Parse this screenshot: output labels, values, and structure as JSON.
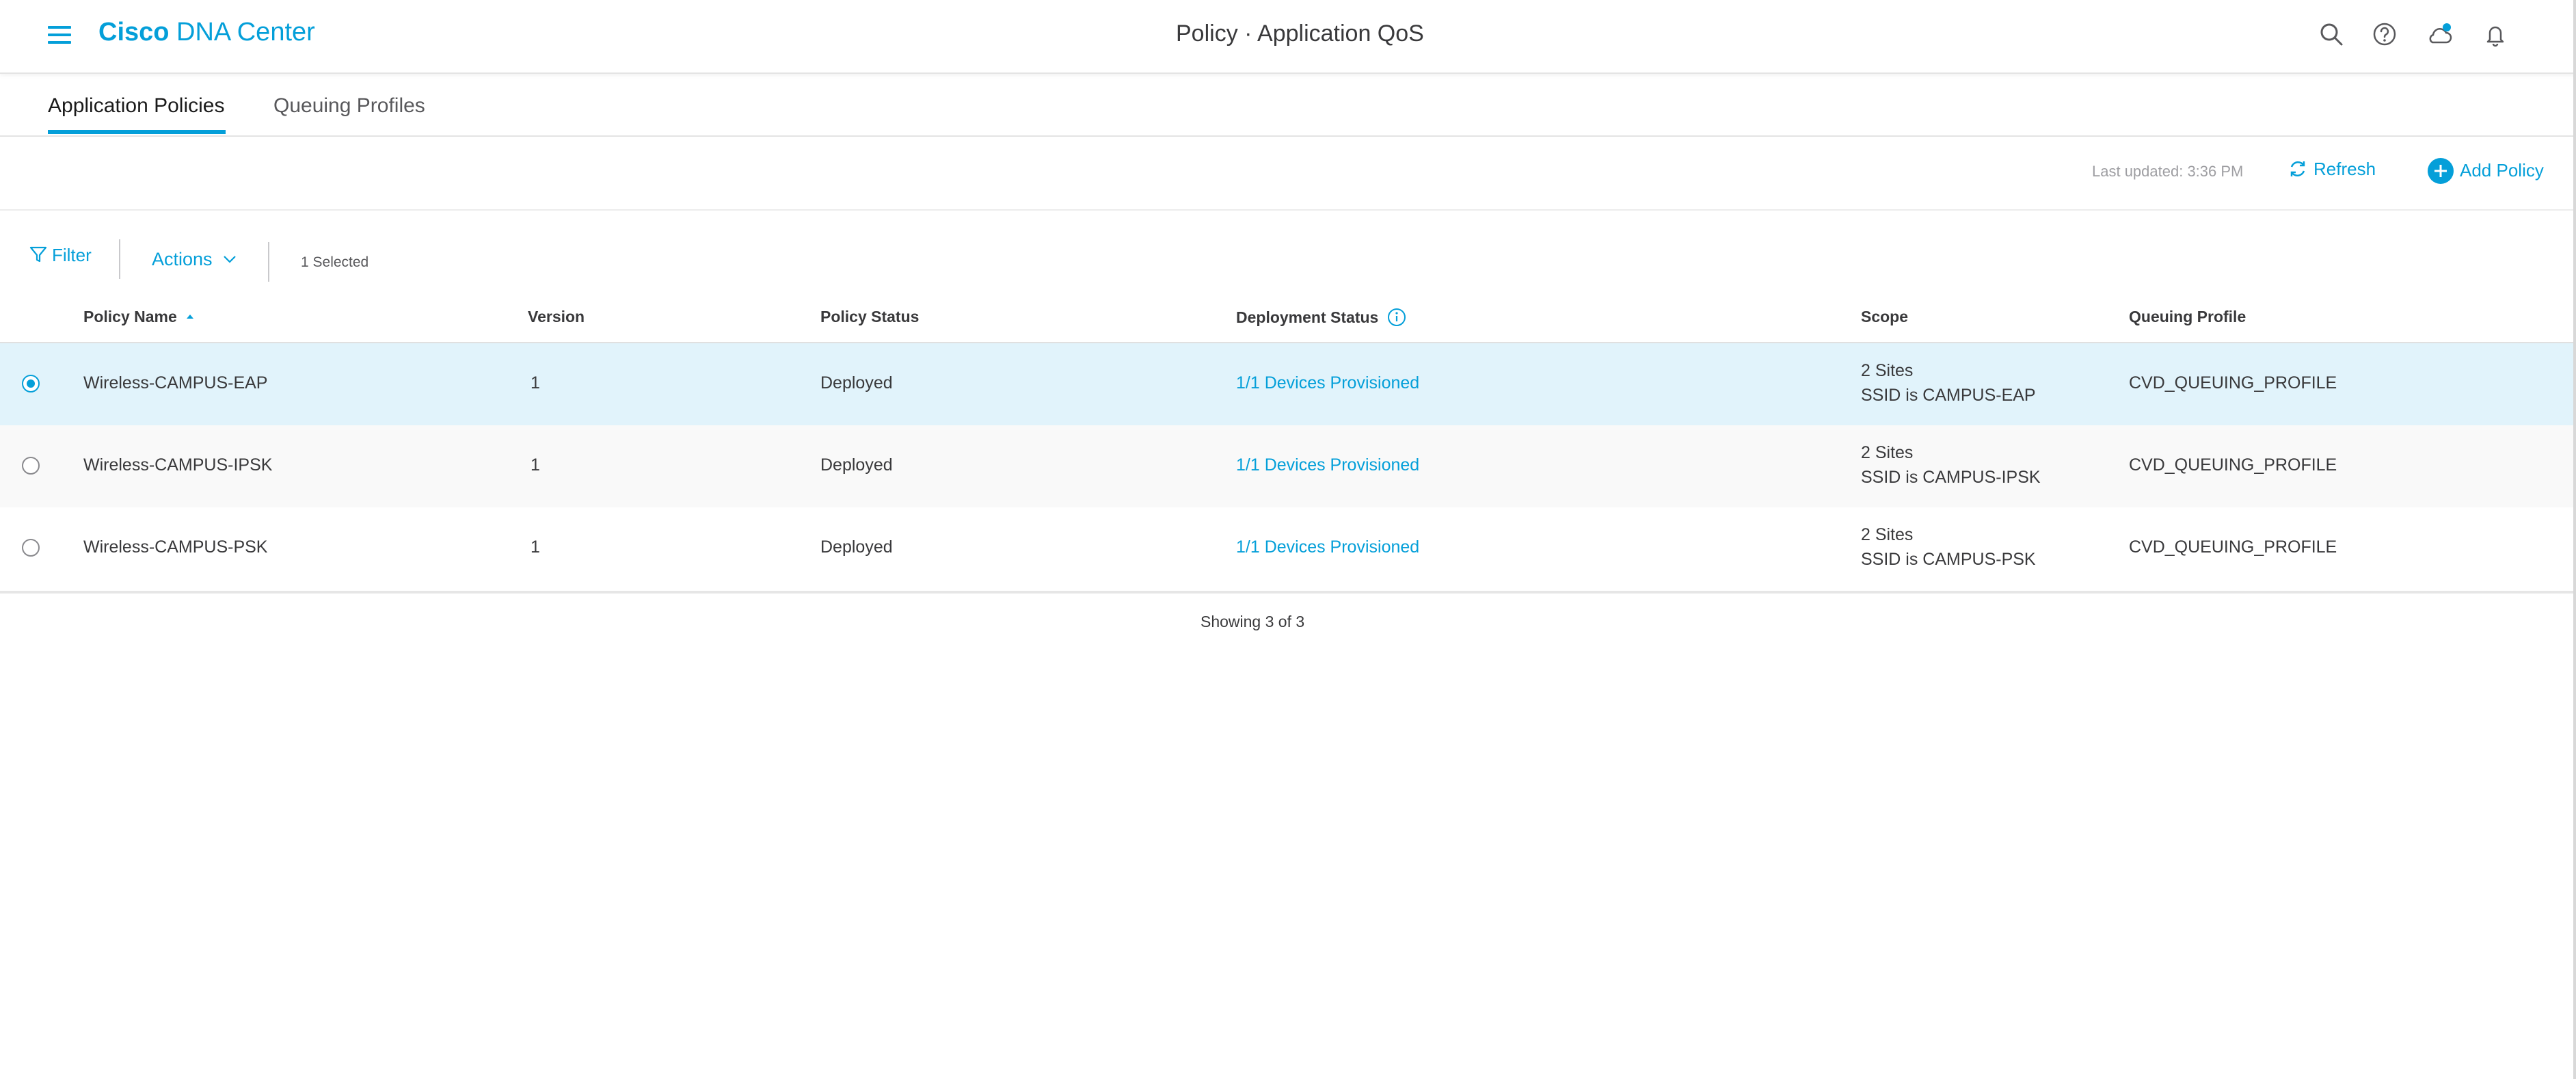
{
  "header": {
    "brand_bold": "Cisco",
    "brand_rest": "DNA Center",
    "page_title": "Policy · Application QoS",
    "icons": [
      "search-icon",
      "help-icon",
      "cloud-notification-icon",
      "bell-icon"
    ]
  },
  "tabs": [
    {
      "label": "Application Policies",
      "active": true
    },
    {
      "label": "Queuing Profiles",
      "active": false
    }
  ],
  "toolbar": {
    "last_updated": "Last updated: 3:36 PM",
    "refresh_label": "Refresh",
    "add_policy_label": "Add Policy",
    "filter_label": "Filter",
    "actions_label": "Actions",
    "selected_text": "1  Selected"
  },
  "table": {
    "columns": [
      "Policy Name",
      "Version",
      "Policy Status",
      "Deployment Status",
      "Scope",
      "Queuing Profile"
    ],
    "rows": [
      {
        "selected": true,
        "name": "Wireless-CAMPUS-EAP",
        "version": "1",
        "status": "Deployed",
        "deployment": "1/1 Devices Provisioned",
        "scope_sites": "2 Sites",
        "scope_ssid": "SSID is CAMPUS-EAP",
        "queuing": "CVD_QUEUING_PROFILE"
      },
      {
        "selected": false,
        "name": "Wireless-CAMPUS-IPSK",
        "version": "1",
        "status": "Deployed",
        "deployment": "1/1 Devices Provisioned",
        "scope_sites": "2 Sites",
        "scope_ssid": "SSID is CAMPUS-IPSK",
        "queuing": "CVD_QUEUING_PROFILE"
      },
      {
        "selected": false,
        "name": "Wireless-CAMPUS-PSK",
        "version": "1",
        "status": "Deployed",
        "deployment": "1/1 Devices Provisioned",
        "scope_sites": "2 Sites",
        "scope_ssid": "SSID is CAMPUS-PSK",
        "queuing": "CVD_QUEUING_PROFILE"
      }
    ],
    "footer": "Showing 3 of 3"
  },
  "colors": {
    "accent": "#049fd9",
    "selected_row": "#e1f3fb"
  }
}
